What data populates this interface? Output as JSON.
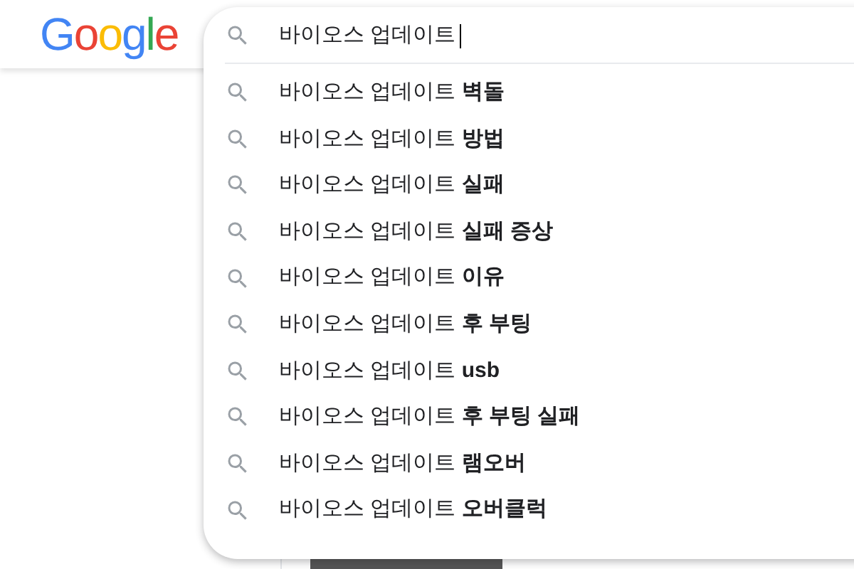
{
  "logo": "Google",
  "search": {
    "value": "바이오스 업데이트"
  },
  "suggestions": [
    "바이오스 업데이트 **벽돌**",
    "바이오스 업데이트 **방법**",
    "바이오스 업데이트 **실패**",
    "바이오스 업데이트 **실패 증상**",
    "바이오스 업데이트 **이유**",
    "바이오스 업데이트 **후 부팅**",
    "바이오스 업데이트 **usb**",
    "바이오스 업데이트 **후 부팅 실패**",
    "바이오스 업데이트 **램오버**",
    "바이오스 업데이트 **오버클럭**"
  ]
}
